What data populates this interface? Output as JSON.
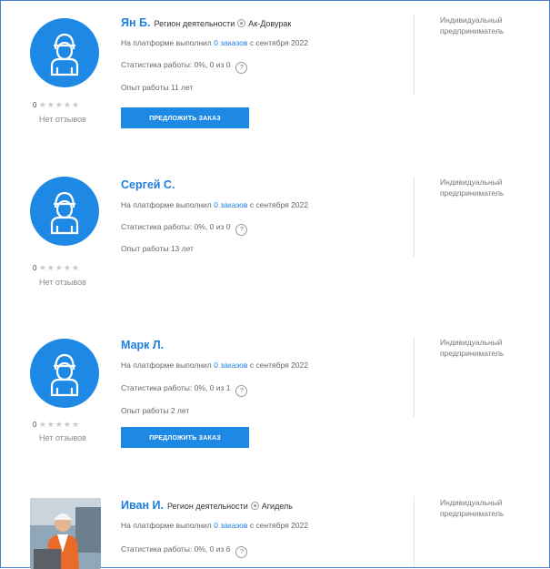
{
  "ui": {
    "region_label": "Регион деятельности",
    "platform_prefix": "На платформе выполнил",
    "orders_link_suffix": "заказов",
    "since_text": "с сентября 2022",
    "stats_prefix": "Статистика работы:",
    "experience_prefix": "Опыт работы",
    "no_reviews": "Нет отзывов",
    "offer_button": "ПРЕДЛОЖИТЬ ЗАКАЗ",
    "help_mark": "?",
    "status_line1": "Индивидуальный",
    "status_line2": "предприниматель"
  },
  "performers": [
    {
      "name": "Ян Б.",
      "region": "Ак-Довурак",
      "orders_count": "0",
      "stats": "0%, 0 из 0",
      "experience": "11 лет",
      "rating": "0",
      "stars": "★★★★★"
    },
    {
      "name": "Сергей С.",
      "region": "",
      "orders_count": "0",
      "stats": "0%, 0 из 0",
      "experience": "13 лет",
      "rating": "0",
      "stars": "★★★★★"
    },
    {
      "name": "Марк Л.",
      "region": "",
      "orders_count": "0",
      "stats": "0%, 0 из 1",
      "experience": "2 лет",
      "rating": "0",
      "stars": "★★★★★"
    },
    {
      "name": "Иван И.",
      "region": "Агидель",
      "orders_count": "0",
      "stats": "0%, 0 из 6",
      "experience": "",
      "rating": "",
      "stars": ""
    }
  ]
}
